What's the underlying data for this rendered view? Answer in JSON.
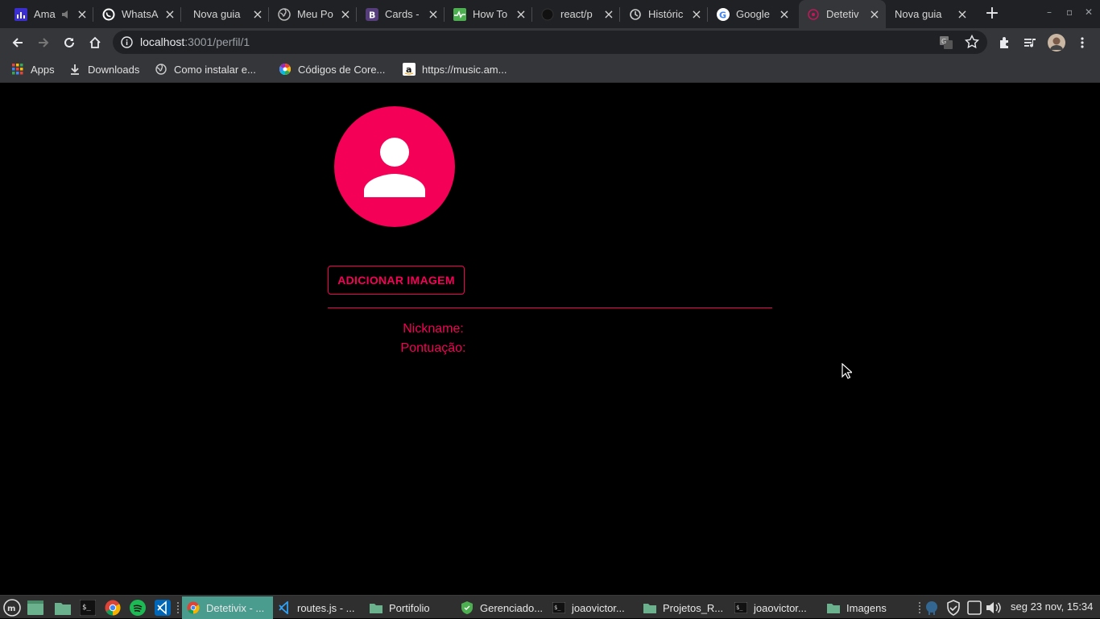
{
  "browser": {
    "tabs": [
      {
        "title": "Ama",
        "icon": "music-bars-icon"
      },
      {
        "title": "WhatsA",
        "icon": "whatsapp-icon"
      },
      {
        "title": "Nova guia",
        "icon": ""
      },
      {
        "title": "Meu Po",
        "icon": "globe-icon"
      },
      {
        "title": "Cards -",
        "icon": "bootstrap-icon"
      },
      {
        "title": "How To",
        "icon": "heartbeat-icon"
      },
      {
        "title": "react/p",
        "icon": "github-icon"
      },
      {
        "title": "Históric",
        "icon": "history-icon"
      },
      {
        "title": "Google",
        "icon": "google-icon"
      },
      {
        "title": "Detetiv",
        "icon": "react-icon"
      },
      {
        "title": "Nova guia",
        "icon": ""
      }
    ],
    "address": {
      "host": "localhost",
      "path": ":3001/perfil/1"
    },
    "bookmarks": [
      {
        "label": "Apps",
        "icon": "apps-grid-icon"
      },
      {
        "label": "Downloads",
        "icon": "download-icon"
      },
      {
        "label": "Como instalar e...",
        "icon": "globe-icon"
      },
      {
        "label": "Códigos de Core...",
        "icon": "color-wheel-icon"
      },
      {
        "label": "https://music.am...",
        "icon": "amazon-icon"
      }
    ]
  },
  "page": {
    "add_image_label": "ADICIONAR IMAGEM",
    "nickname_label": "Nickname:",
    "score_label": "Pontuação:"
  },
  "taskbar": {
    "tasks": [
      {
        "label": "Detetivix - ...",
        "icon": "chrome-icon"
      },
      {
        "label": "routes.js - ...",
        "icon": "vscode-icon"
      },
      {
        "label": "Portifolio",
        "icon": "folder-icon"
      },
      {
        "label": "Gerenciado...",
        "icon": "shield-icon"
      },
      {
        "label": "joaovictor...",
        "icon": "terminal-icon"
      },
      {
        "label": "Projetos_R...",
        "icon": "folder-icon"
      },
      {
        "label": "joaovictor...",
        "icon": "terminal-icon"
      },
      {
        "label": "Imagens",
        "icon": "folder-icon"
      }
    ],
    "clock": "seg 23 nov, 15:34"
  },
  "colors": {
    "accent": "#f50057",
    "active_task": "#4a9c8f"
  }
}
